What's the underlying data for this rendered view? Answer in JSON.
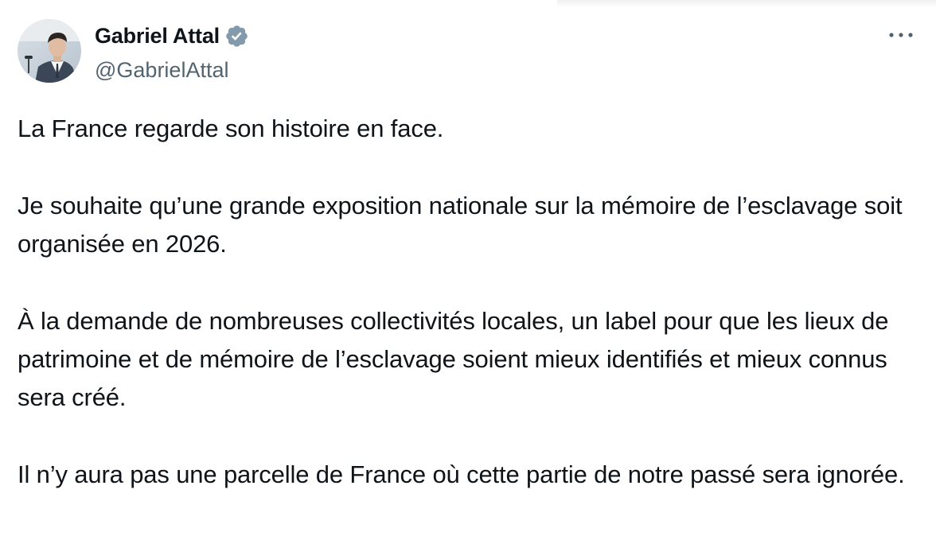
{
  "author": {
    "display_name": "Gabriel Attal",
    "handle": "@GabrielAttal",
    "verified": true,
    "avatar_icon": "profile-photo",
    "verified_badge_color": "#829aab"
  },
  "actions": {
    "more_icon": "more-horizontal-icon"
  },
  "tweet": {
    "paragraphs": [
      "La France regarde son histoire en face.",
      "Je souhaite qu’une grande exposition nationale sur la mémoire de l’esclavage soit organisée en 2026.",
      "À la demande de nombreuses collectivités locales, un label pour que les lieux de patrimoine et de mémoire de l’esclavage soient mieux identifiés et mieux connus sera créé.",
      "Il n’y aura pas une parcelle de France où cette partie de notre passé sera ignorée."
    ]
  },
  "colors": {
    "text": "#0f1419",
    "secondary_text": "#536471",
    "background": "#ffffff"
  }
}
